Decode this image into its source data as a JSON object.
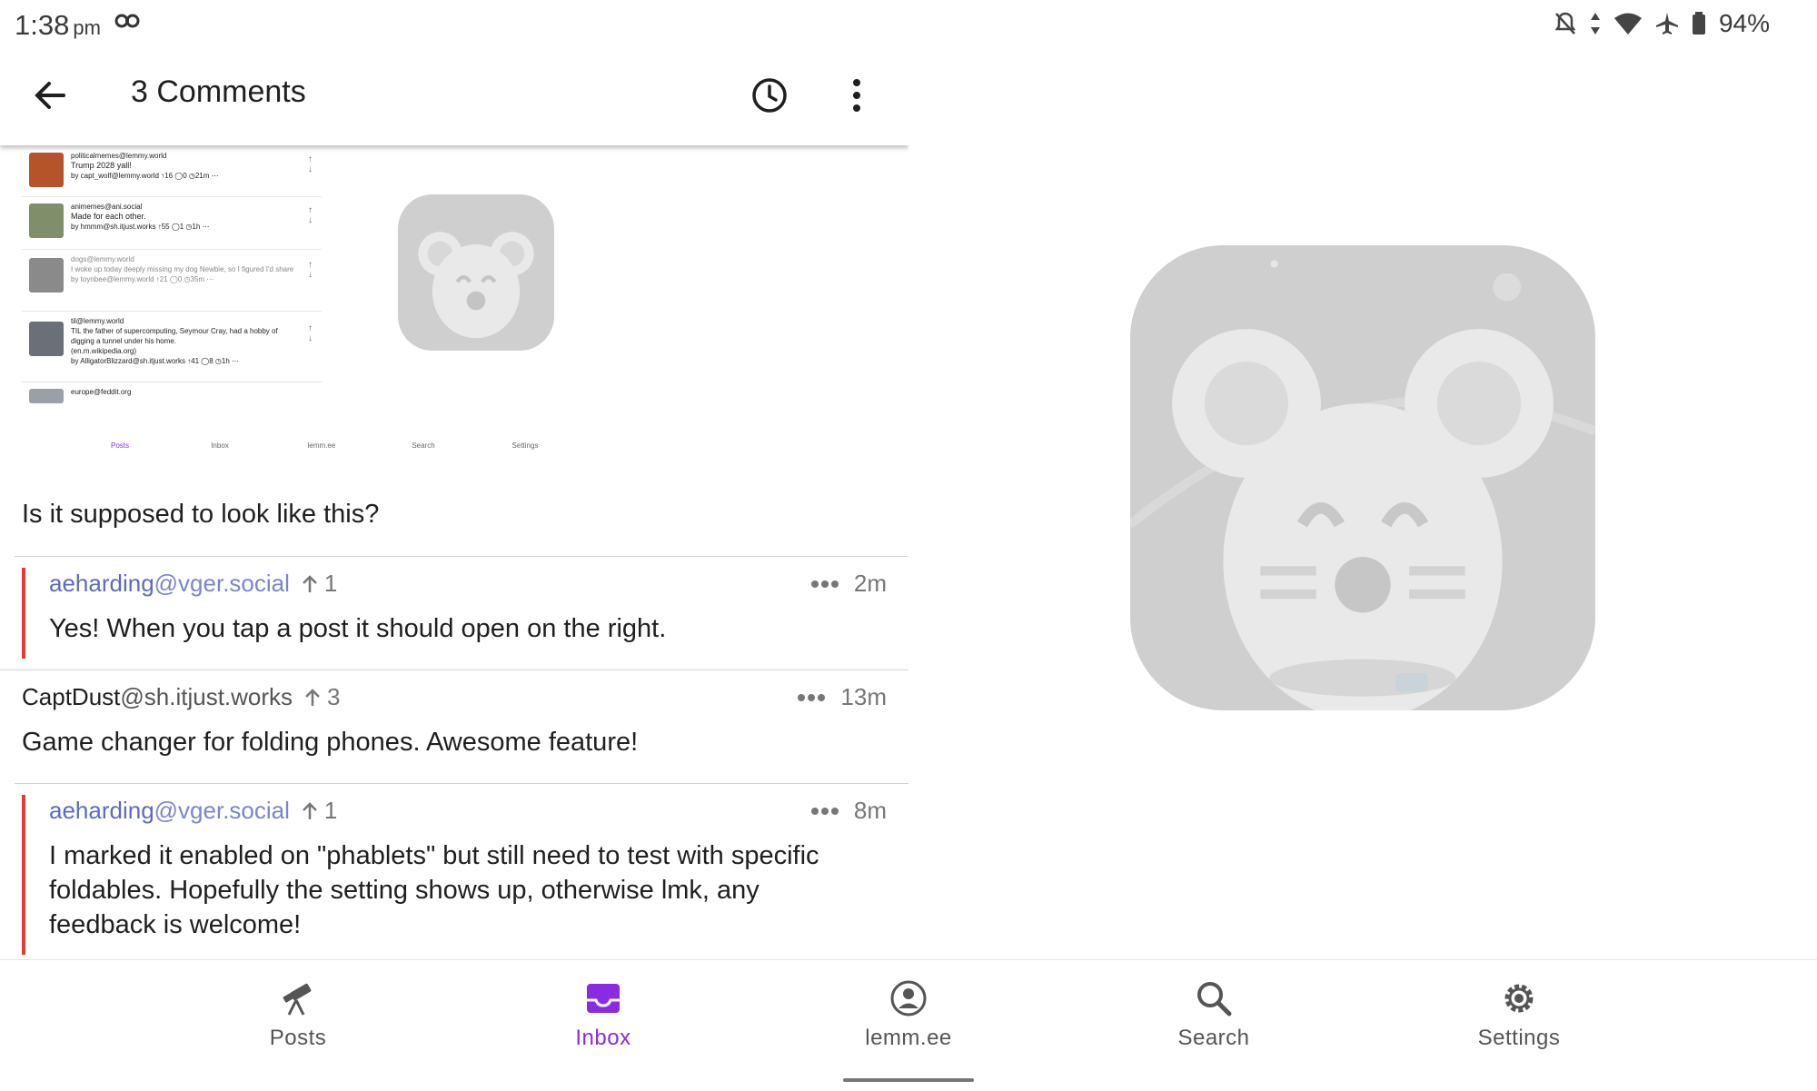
{
  "status_bar": {
    "time": "1:38",
    "ampm": "pm",
    "battery": "94%",
    "icons": [
      "incognito-icon",
      "notifications-off-icon",
      "data-arrows-icon",
      "wifi-icon",
      "airplane-icon",
      "battery-icon"
    ]
  },
  "app_bar": {
    "title": "3 Comments",
    "icons": [
      "back-arrow-icon",
      "history-icon",
      "more-vert-icon"
    ]
  },
  "embedded_screenshot": {
    "rows": [
      {
        "community": "politicalmemes@lemmy.world",
        "title": "Trump 2028 yall!",
        "meta": "by capt_wolf@lemmy.world ↑16 ◯0 ◷21m ⋯"
      },
      {
        "community": "animemes@ani.social",
        "title": "Made for each other.",
        "meta": "by hmmm@sh.itjust.works ↑55 ◯1 ◷1h ⋯"
      },
      {
        "community": "dogs@lemmy.world",
        "title": "I woke up today deeply missing my dog Newbie, so I figured I'd share",
        "meta": "by toynbee@lemmy.world ↑21 ◯0 ◷35m ⋯"
      },
      {
        "community": "til@lemmy.world",
        "title": "TIL the father of supercomputing, Seymour Cray, had a hobby of digging a tunnel under his home.",
        "link": "(en.m.wikipedia.org)",
        "meta": "by AlligatorBlizzard@sh.itjust.works ↑41 ◯8 ◷1h ⋯"
      },
      {
        "community": "europe@feddit.org",
        "title": "",
        "meta": ""
      }
    ],
    "nav": [
      "Posts",
      "Inbox",
      "lemm.ee",
      "Search",
      "Settings"
    ]
  },
  "post": {
    "body": "Is it supposed to look like this?"
  },
  "comments": [
    {
      "user": "aeharding",
      "instance": "@vger.social",
      "score": "1",
      "age": "2m",
      "body": "Yes! When you tap a post it should open on the right.",
      "nested": true
    },
    {
      "user": "CaptDust",
      "instance": "@sh.itjust.works",
      "score": "3",
      "age": "13m",
      "body": "Game changer for folding phones. Awesome feature!",
      "nested": false
    },
    {
      "user": "aeharding",
      "instance": "@vger.social",
      "score": "1",
      "age": "8m",
      "body": "I marked it enabled on \"phablets\" but still need to test with specific foldables. Hopefully the setting shows up, otherwise lmk, any feedback is welcome!",
      "nested": true
    }
  ],
  "bottom_nav": {
    "items": [
      {
        "label": "Posts",
        "icon": "telescope-icon",
        "active": false
      },
      {
        "label": "Inbox",
        "icon": "inbox-icon",
        "active": true
      },
      {
        "label": "lemm.ee",
        "icon": "account-circle-icon",
        "active": false
      },
      {
        "label": "Search",
        "icon": "search-icon",
        "active": false
      },
      {
        "label": "Settings",
        "icon": "gear-icon",
        "active": false
      }
    ]
  },
  "colors": {
    "accent": "#8a2be2",
    "username": "#5c6bc0",
    "thread_bar": "#e53935"
  }
}
